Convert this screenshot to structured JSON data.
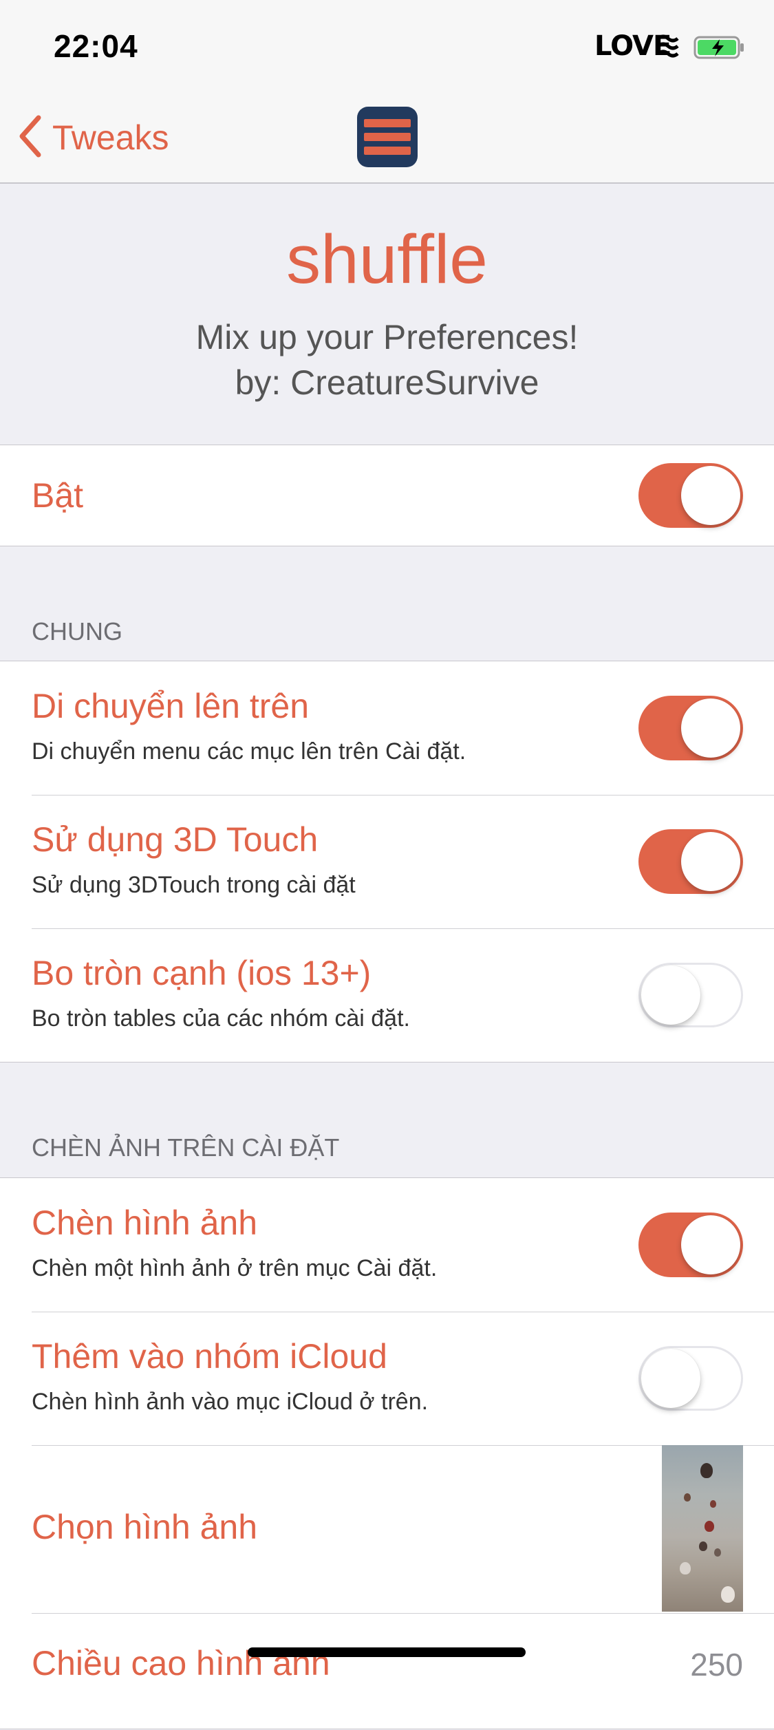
{
  "status_bar": {
    "time": "22:04",
    "carrier": "LOVE",
    "battery_state": "charging",
    "colors": {
      "battery_fill": "#4cd964"
    }
  },
  "nav": {
    "back_label": "Tweaks",
    "logo_icon": "stacked-lines-logo-icon"
  },
  "header": {
    "title": "shuffle",
    "subtitle": "Mix up your Preferences!",
    "author": "by: CreatureSurvive"
  },
  "enable": {
    "label": "Bật",
    "on": true
  },
  "general": {
    "header": "CHUNG",
    "rows": [
      {
        "title": "Di chuyển lên trên",
        "desc": "Di chuyển menu các mục lên trên Cài đặt.",
        "on": true
      },
      {
        "title": "Sử dụng 3D Touch",
        "desc": "Sử dụng 3DTouch trong cài đặt",
        "on": true
      },
      {
        "title": "Bo tròn cạnh (ios 13+)",
        "desc": "Bo tròn tables của các nhóm cài đặt.",
        "on": false
      }
    ]
  },
  "image_section": {
    "header": "CHÈN ẢNH TRÊN CÀI ĐẶT",
    "rows": [
      {
        "title": "Chèn hình ảnh",
        "desc": "Chèn một hình ảnh ở trên mục Cài đặt.",
        "on": true
      },
      {
        "title": "Thêm vào nhóm iCloud",
        "desc": "Chèn hình ảnh vào mục iCloud ở trên.",
        "on": false
      }
    ],
    "choose_label": "Chọn hình ảnh",
    "height_label": "Chiều cao hình ảnh",
    "height_value": "250"
  },
  "colors": {
    "accent": "#e06449",
    "background": "#efeff4",
    "logo_bg": "#223a5e"
  }
}
